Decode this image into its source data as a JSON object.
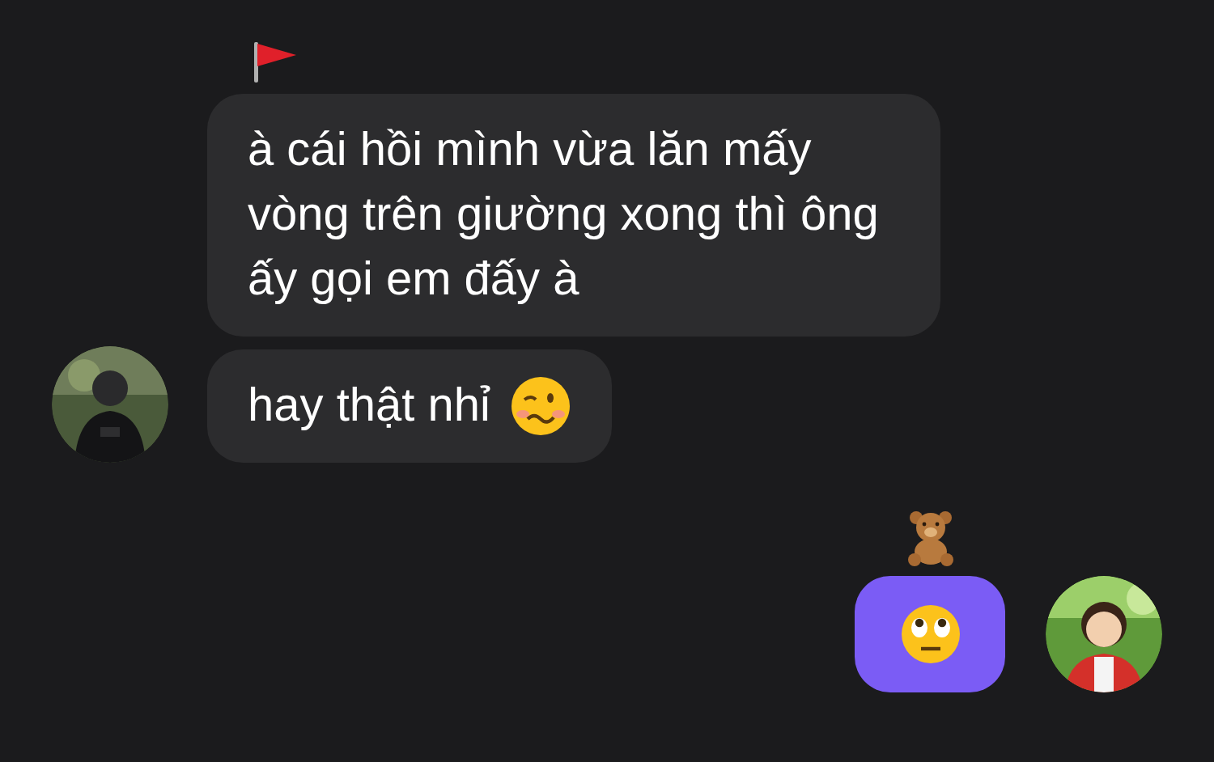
{
  "incoming": [
    {
      "kind": "text",
      "text": "à cái hồi mình vừa lăn mấy vòng trên giường xong thì ông ấy gọi em đấy à",
      "reaction": {
        "kind": "flag"
      },
      "avatar": false
    },
    {
      "kind": "text",
      "text": "hay thật nhỉ",
      "emoji": {
        "kind": "woozy"
      },
      "avatar": true
    }
  ],
  "outgoing": [
    {
      "kind": "emoji",
      "emoji": {
        "kind": "eye-roll"
      },
      "reaction": {
        "kind": "teddy"
      },
      "avatar": true
    }
  ]
}
